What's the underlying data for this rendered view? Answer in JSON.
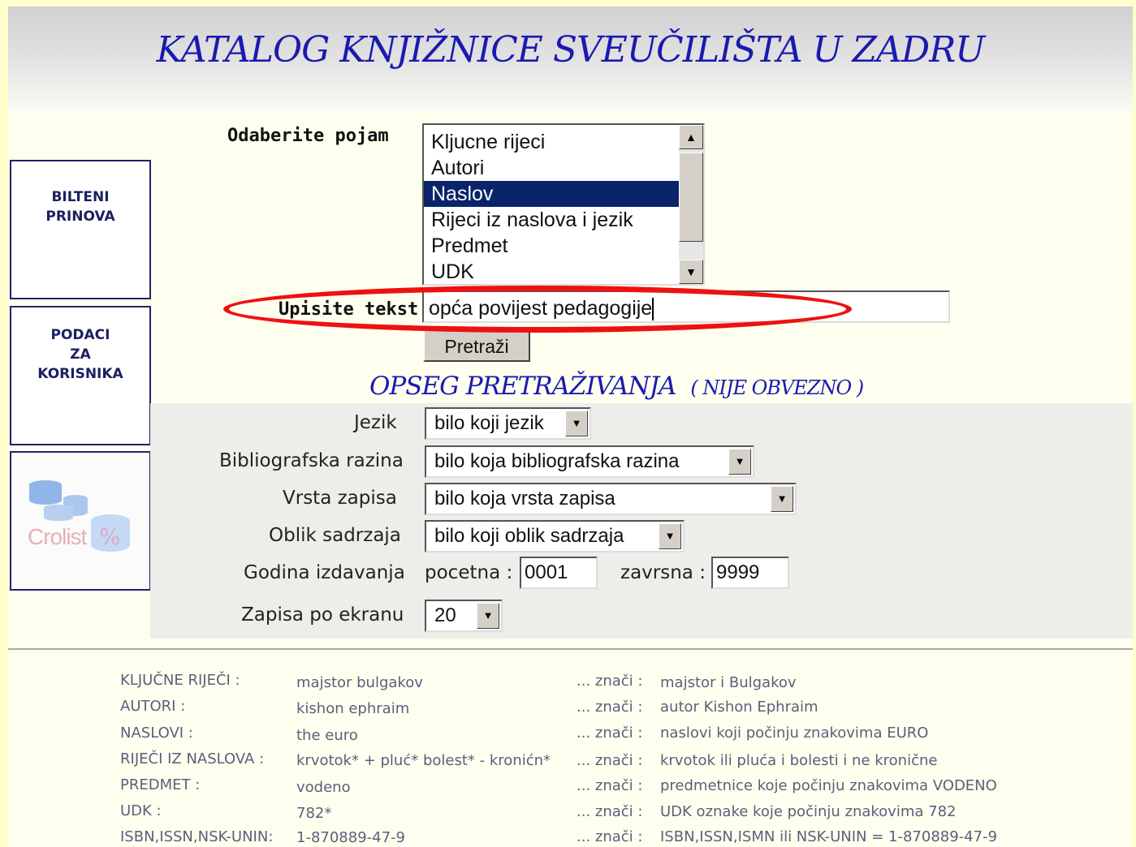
{
  "title": "KATALOG KNJIŽNICE SVEUČILIŠTA U ZADRU",
  "sidebar": {
    "bilteni": [
      "BILTENI",
      "PRINOVA"
    ],
    "podaci": [
      "PODACI",
      "ZA",
      "KORISNIKA"
    ],
    "crolist_logo": "Crolist",
    "crolist_pct": "%"
  },
  "form": {
    "choose_label": "Odaberite pojam",
    "options": [
      "Kljucne rijeci",
      "Autori",
      "Naslov",
      "Rijeci iz naslova i jezik",
      "Predmet",
      "UDK"
    ],
    "selected_option": "Naslov",
    "text_label": "Upisite tekst",
    "text_value": "opća povijest pedagogije",
    "search_button": "Pretraži"
  },
  "scope": {
    "heading": "OPSEG PRETRAŽIVANJA",
    "note": "( NIJE OBVEZNO )",
    "language_label": "Jezik",
    "language_value": "bilo koji jezik",
    "bib_level_label": "Bibliografska razina",
    "bib_level_value": "bilo koja bibliografska razina",
    "record_type_label": "Vrsta zapisa",
    "record_type_value": "bilo koja vrsta zapisa",
    "content_form_label": "Oblik sadrzaja",
    "content_form_value": "bilo koji oblik sadrzaja",
    "year_label": "Godina izdavanja",
    "year_start_label": "pocetna :",
    "year_start_value": "0001",
    "year_end_label": "zavrsna :",
    "year_end_value": "9999",
    "per_page_label": "Zapisa po ekranu",
    "per_page_value": "20"
  },
  "help": [
    {
      "field": "KLJUČNE RIJEČI :",
      "example": "majstor bulgakov",
      "means": "... znači :",
      "meaning": "majstor i Bulgakov"
    },
    {
      "field": "AUTORI :",
      "example": "kishon ephraim",
      "means": "... znači :",
      "meaning": "autor Kishon Ephraim"
    },
    {
      "field": "NASLOVI :",
      "example": "the euro",
      "means": "... znači :",
      "meaning": "naslovi koji počinju znakovima EURO"
    },
    {
      "field": "RIJEČI IZ NASLOVA :",
      "example": "krvotok* + pluć* bolest* - kronićn*",
      "means": "... znači :",
      "meaning": "krvotok ili pluća i bolesti i ne kronične"
    },
    {
      "field": "PREDMET :",
      "example": "vodeno",
      "means": "... znači :",
      "meaning": "predmetnice koje počinju znakovima VODENO"
    },
    {
      "field": "UDK :",
      "example": "782*",
      "means": "... znači :",
      "meaning": "UDK oznake koje počinju znakovima 782"
    },
    {
      "field": "ISBN,ISSN,NSK-UNIN:",
      "example": "1-870889-47-9",
      "means": "... znači :",
      "meaning": "ISBN,ISSN,ISMN ili NSK-UNIN = 1-870889-47-9"
    }
  ]
}
